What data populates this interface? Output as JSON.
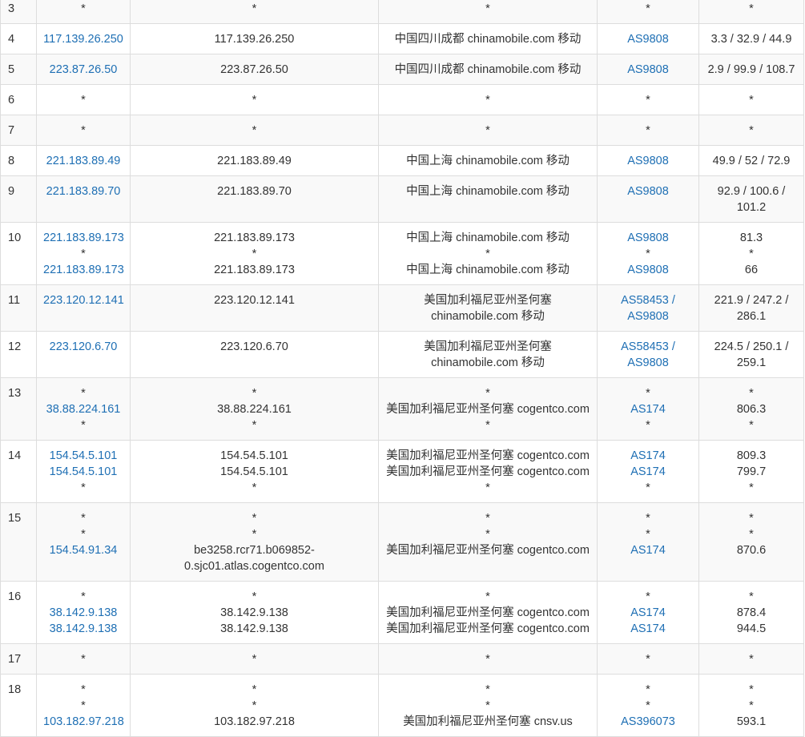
{
  "rows": [
    {
      "hop": "3",
      "ip": [
        "*"
      ],
      "host": [
        "*"
      ],
      "loc": [
        "*"
      ],
      "asn": [
        "*"
      ],
      "lat": [
        "*"
      ]
    },
    {
      "hop": "4",
      "ip": [
        "117.139.26.250"
      ],
      "host": [
        "117.139.26.250"
      ],
      "loc": [
        "中国四川成都 chinamobile.com 移动"
      ],
      "asn": [
        "AS9808"
      ],
      "lat": [
        "3.3 / 32.9 / 44.9"
      ]
    },
    {
      "hop": "5",
      "ip": [
        "223.87.26.50"
      ],
      "host": [
        "223.87.26.50"
      ],
      "loc": [
        "中国四川成都 chinamobile.com 移动"
      ],
      "asn": [
        "AS9808"
      ],
      "lat": [
        "2.9 / 99.9 / 108.7"
      ]
    },
    {
      "hop": "6",
      "ip": [
        "*"
      ],
      "host": [
        "*"
      ],
      "loc": [
        "*"
      ],
      "asn": [
        "*"
      ],
      "lat": [
        "*"
      ]
    },
    {
      "hop": "7",
      "ip": [
        "*"
      ],
      "host": [
        "*"
      ],
      "loc": [
        "*"
      ],
      "asn": [
        "*"
      ],
      "lat": [
        "*"
      ]
    },
    {
      "hop": "8",
      "ip": [
        "221.183.89.49"
      ],
      "host": [
        "221.183.89.49"
      ],
      "loc": [
        "中国上海 chinamobile.com 移动"
      ],
      "asn": [
        "AS9808"
      ],
      "lat": [
        "49.9 / 52 / 72.9"
      ]
    },
    {
      "hop": "9",
      "ip": [
        "221.183.89.70"
      ],
      "host": [
        "221.183.89.70"
      ],
      "loc": [
        "中国上海 chinamobile.com 移动"
      ],
      "asn": [
        "AS9808"
      ],
      "lat": [
        "92.9 / 100.6 / 101.2"
      ]
    },
    {
      "hop": "10",
      "ip": [
        "221.183.89.173",
        "*",
        "221.183.89.173"
      ],
      "host": [
        "221.183.89.173",
        "*",
        "221.183.89.173"
      ],
      "loc": [
        "中国上海 chinamobile.com 移动",
        "*",
        "中国上海 chinamobile.com 移动"
      ],
      "asn": [
        "AS9808",
        "*",
        "AS9808"
      ],
      "lat": [
        "81.3",
        "*",
        "66"
      ]
    },
    {
      "hop": "11",
      "ip": [
        "223.120.12.141"
      ],
      "host": [
        "223.120.12.141"
      ],
      "loc": [
        "美国加利福尼亚州圣何塞 chinamobile.com 移动"
      ],
      "asn": [
        "AS58453 / AS9808"
      ],
      "lat": [
        "221.9 / 247.2 / 286.1"
      ]
    },
    {
      "hop": "12",
      "ip": [
        "223.120.6.70"
      ],
      "host": [
        "223.120.6.70"
      ],
      "loc": [
        "美国加利福尼亚州圣何塞 chinamobile.com 移动"
      ],
      "asn": [
        "AS58453 / AS9808"
      ],
      "lat": [
        "224.5 / 250.1 / 259.1"
      ]
    },
    {
      "hop": "13",
      "ip": [
        "*",
        "38.88.224.161",
        "*"
      ],
      "host": [
        "*",
        "38.88.224.161",
        "*"
      ],
      "loc": [
        "*",
        "美国加利福尼亚州圣何塞 cogentco.com",
        "*"
      ],
      "asn": [
        "*",
        "AS174",
        "*"
      ],
      "lat": [
        "*",
        "806.3",
        "*"
      ]
    },
    {
      "hop": "14",
      "ip": [
        "154.54.5.101",
        "154.54.5.101",
        "*"
      ],
      "host": [
        "154.54.5.101",
        "154.54.5.101",
        "*"
      ],
      "loc": [
        "美国加利福尼亚州圣何塞 cogentco.com",
        "美国加利福尼亚州圣何塞 cogentco.com",
        "*"
      ],
      "asn": [
        "AS174",
        "AS174",
        "*"
      ],
      "lat": [
        "809.3",
        "799.7",
        "*"
      ]
    },
    {
      "hop": "15",
      "ip": [
        "*",
        "*",
        "154.54.91.34"
      ],
      "host": [
        "*",
        "*",
        "be3258.rcr71.b069852-0.sjc01.atlas.cogentco.com"
      ],
      "loc": [
        "*",
        "*",
        "美国加利福尼亚州圣何塞 cogentco.com"
      ],
      "asn": [
        "*",
        "*",
        "AS174"
      ],
      "lat": [
        "*",
        "*",
        "870.6"
      ]
    },
    {
      "hop": "16",
      "ip": [
        "*",
        "38.142.9.138",
        "38.142.9.138"
      ],
      "host": [
        "*",
        "38.142.9.138",
        "38.142.9.138"
      ],
      "loc": [
        "*",
        "美国加利福尼亚州圣何塞 cogentco.com",
        "美国加利福尼亚州圣何塞 cogentco.com"
      ],
      "asn": [
        "*",
        "AS174",
        "AS174"
      ],
      "lat": [
        "*",
        "878.4",
        "944.5"
      ]
    },
    {
      "hop": "17",
      "ip": [
        "*"
      ],
      "host": [
        "*"
      ],
      "loc": [
        "*"
      ],
      "asn": [
        "*"
      ],
      "lat": [
        "*"
      ]
    },
    {
      "hop": "18",
      "ip": [
        "*",
        "*",
        "103.182.97.218"
      ],
      "host": [
        "*",
        "*",
        "103.182.97.218"
      ],
      "loc": [
        "*",
        "*",
        "美国加利福尼亚州圣何塞 cnsv.us"
      ],
      "asn": [
        "*",
        "*",
        "AS396073"
      ],
      "lat": [
        "*",
        "*",
        "593.1"
      ]
    }
  ]
}
